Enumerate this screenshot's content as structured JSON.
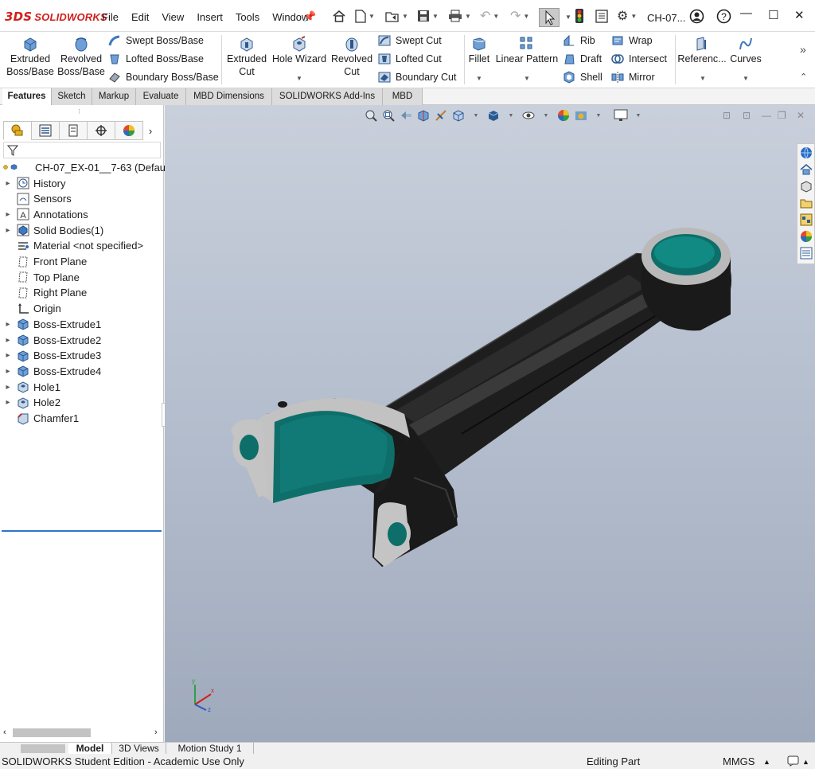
{
  "app": {
    "logo_text": "SOLIDWORKS",
    "logo_mark": "3DS",
    "menu": [
      "File",
      "Edit",
      "View",
      "Insert",
      "Tools",
      "Window"
    ],
    "document_title": "CH-07...",
    "quick_access_icons": [
      "home-icon",
      "new-document-icon",
      "open-icon",
      "save-icon",
      "print-icon",
      "undo-icon",
      "redo-icon",
      "select-icon",
      "rebuild-icon",
      "file-properties-icon",
      "options-icon"
    ],
    "window_controls": [
      "account-icon",
      "help-icon",
      "minimize-icon",
      "maximize-icon",
      "close-icon"
    ],
    "accent_color": "#d0201c"
  },
  "ribbon": {
    "extruded_boss": "Extruded Boss/Base",
    "revolved_boss": "Revolved Boss/Base",
    "swept_boss": "Swept Boss/Base",
    "lofted_boss": "Lofted Boss/Base",
    "boundary_boss": "Boundary Boss/Base",
    "extruded_cut": "Extruded Cut",
    "hole_wizard": "Hole Wizard",
    "revolved_cut": "Revolved Cut",
    "swept_cut": "Swept Cut",
    "lofted_cut": "Lofted Cut",
    "boundary_cut": "Boundary Cut",
    "fillet": "Fillet",
    "linear_pattern": "Linear Pattern",
    "rib": "Rib",
    "draft": "Draft",
    "shell": "Shell",
    "wrap": "Wrap",
    "intersect": "Intersect",
    "mirror": "Mirror",
    "reference": "Referenc...",
    "curves": "Curves"
  },
  "tabs": [
    "Features",
    "Sketch",
    "Markup",
    "Evaluate",
    "MBD Dimensions",
    "SOLIDWORKS Add-Ins",
    "MBD"
  ],
  "active_tab": "Features",
  "feature_tree": {
    "root": "CH-07_EX-01__7-63  (Defau",
    "items": [
      {
        "label": "History",
        "expandable": true,
        "icon": "history-icon"
      },
      {
        "label": "Sensors",
        "expandable": false,
        "icon": "sensors-icon"
      },
      {
        "label": "Annotations",
        "expandable": true,
        "icon": "annotations-icon"
      },
      {
        "label": "Solid Bodies(1)",
        "expandable": true,
        "icon": "solid-bodies-icon"
      },
      {
        "label": "Material <not specified>",
        "expandable": false,
        "icon": "material-icon"
      },
      {
        "label": "Front Plane",
        "expandable": false,
        "icon": "plane-icon"
      },
      {
        "label": "Top Plane",
        "expandable": false,
        "icon": "plane-icon"
      },
      {
        "label": "Right Plane",
        "expandable": false,
        "icon": "plane-icon"
      },
      {
        "label": "Origin",
        "expandable": false,
        "icon": "origin-icon"
      },
      {
        "label": "Boss-Extrude1",
        "expandable": true,
        "icon": "extrude-icon"
      },
      {
        "label": "Boss-Extrude2",
        "expandable": true,
        "icon": "extrude-icon"
      },
      {
        "label": "Boss-Extrude3",
        "expandable": true,
        "icon": "extrude-icon"
      },
      {
        "label": "Boss-Extrude4",
        "expandable": true,
        "icon": "extrude-icon"
      },
      {
        "label": "Hole1",
        "expandable": true,
        "icon": "hole-icon"
      },
      {
        "label": "Hole2",
        "expandable": true,
        "icon": "hole-icon"
      },
      {
        "label": "Chamfer1",
        "expandable": false,
        "icon": "chamfer-icon"
      }
    ]
  },
  "panel_tabs": [
    "feature-manager-icon",
    "property-manager-icon",
    "configuration-manager-icon",
    "dimxpert-icon",
    "display-manager-icon"
  ],
  "bottom_tabs": [
    "Model",
    "3D Views",
    "Motion Study 1"
  ],
  "status": {
    "edition": "SOLIDWORKS Student Edition - Academic Use Only",
    "mode": "Editing Part",
    "units": "MMGS"
  },
  "triad_axes": {
    "x": "x",
    "y": "y",
    "z": "z"
  },
  "model_colors": {
    "body": "#1e1e1e",
    "bore": "#0e6e6a",
    "cut_face": "#c9c9c9"
  }
}
